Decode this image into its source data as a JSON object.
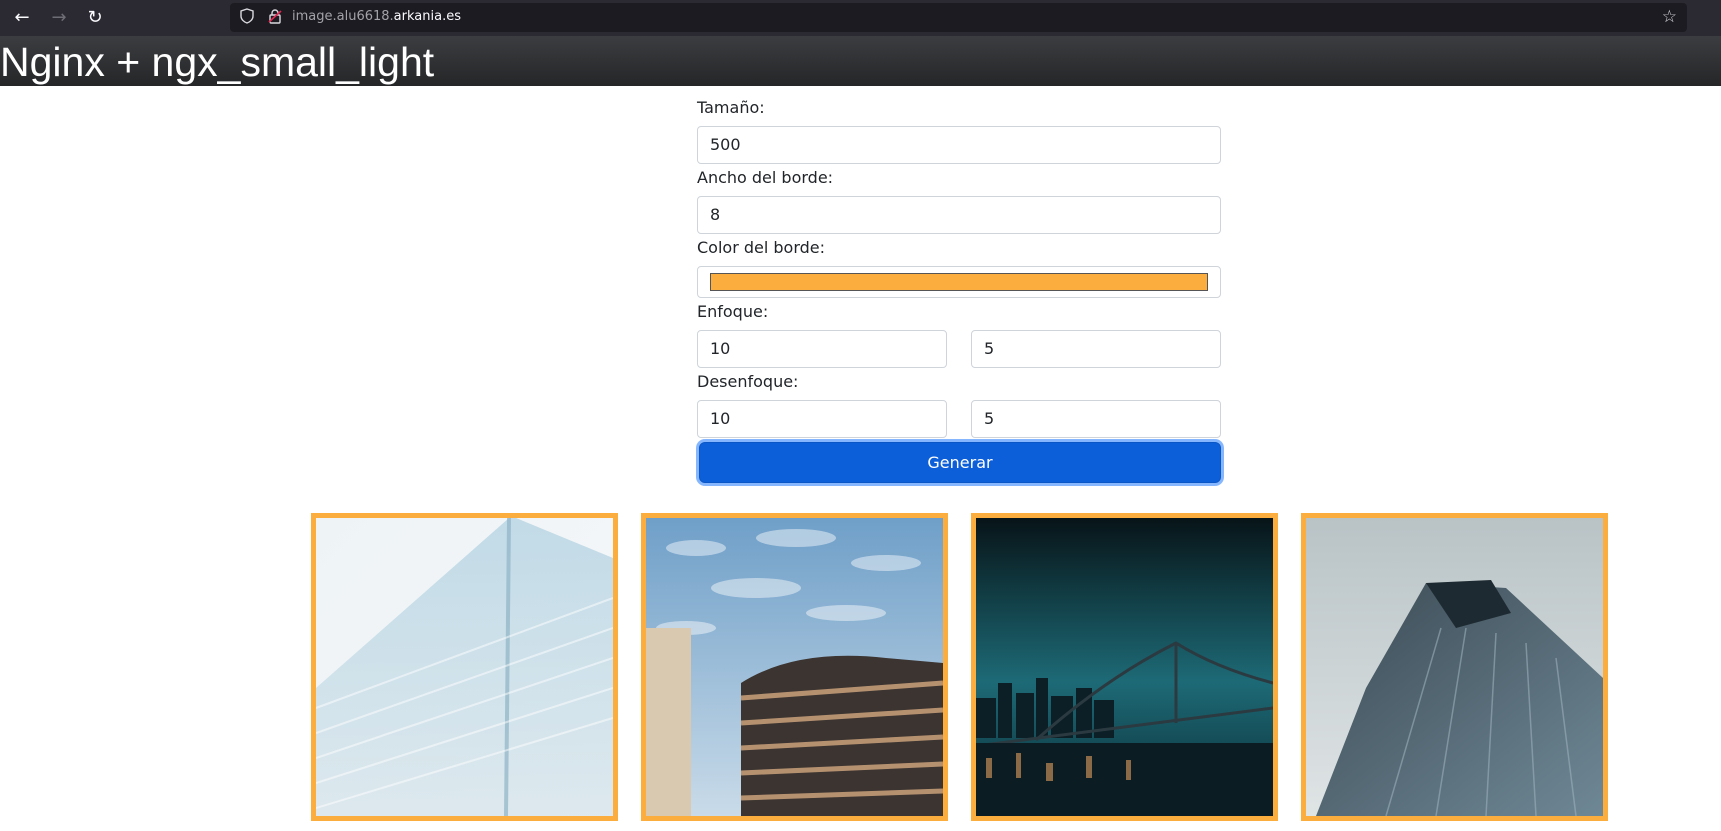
{
  "browser": {
    "url_prefix": "image.alu6618.",
    "url_domain": "arkania.es",
    "icons": {
      "back": "arrow-left-icon",
      "forward": "arrow-right-icon",
      "reload": "reload-icon",
      "tracking": "shield-icon",
      "insecure": "lock-icon",
      "bookmark": "star-icon"
    }
  },
  "header": {
    "title": "Nginx + ngx_small_light"
  },
  "form": {
    "size_label": "Tamaño:",
    "size_value": "500",
    "border_width_label": "Ancho del borde:",
    "border_width_value": "8",
    "border_color_label": "Color del borde:",
    "border_color_value": "#fbad3d",
    "sharpen_label": "Enfoque:",
    "sharpen_value_1": "10",
    "sharpen_value_2": "5",
    "blur_label": "Desenfoque:",
    "blur_value_1": "10",
    "blur_value_2": "5",
    "generate_label": "Generar"
  },
  "gallery": {
    "border_color": "#fbad3d",
    "images": [
      "white-glass-building-image",
      "curved-building-sky-image",
      "night-bridge-city-image",
      "angled-skyscraper-image"
    ]
  },
  "colors": {
    "accent": "#0d5fd9",
    "header_bg": "#2e3033",
    "browser_bg": "#2b2a33"
  }
}
